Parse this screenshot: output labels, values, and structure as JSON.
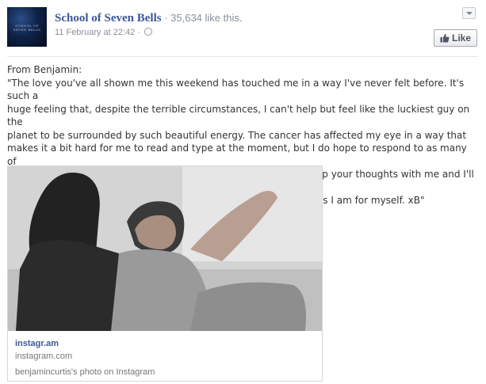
{
  "header": {
    "avatar_text": "SCHOOL OF SEVEN BELLS",
    "page_name": "School of Seven Bells",
    "likes": " · 35,634 like this.",
    "timestamp": "11 February at 22:42 · "
  },
  "like_button": {
    "label": "Like"
  },
  "post": {
    "lines": [
      "From Benjamin:",
      "\"The love you've all shown me this weekend has touched me in a way I've never felt before. It's such a",
      "huge feeling that, despite the terrible circumstances, I can't help but feel like the luckiest guy on the",
      "planet to be surrounded by such beautiful energy. The cancer has affected my eye in a way that",
      "makes it a bit hard for me to read and type at the moment, but I do hope to respond to as many of",
      "you as I can as that changes. Please bear with me. Until then, keep your thoughts with me and I'll be",
      "keeping mine with you. I'm gonna beat this for you just as much as I am for myself. xB\""
    ]
  },
  "attachment": {
    "title": "instagr.am",
    "domain": "instagram.com",
    "caption": "benjamincurtis's photo on Instagram"
  },
  "icons": {
    "globe": "globe-icon",
    "chevron": "chevron-down-icon",
    "thumb": "thumbs-up-icon"
  },
  "colors": {
    "link": "#3b5998",
    "muted": "#898f9c",
    "text": "#333333"
  }
}
